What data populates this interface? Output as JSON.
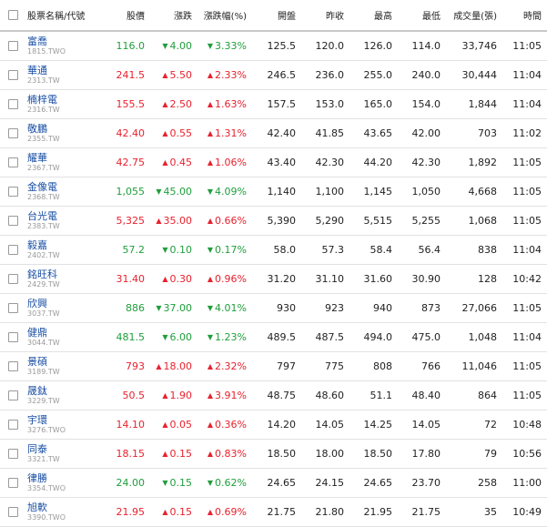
{
  "headers": {
    "name": "股票名稱/代號",
    "price": "股價",
    "change": "漲跌",
    "change_pct": "漲跌幅(%)",
    "open": "開盤",
    "prev_close": "昨收",
    "high": "最高",
    "low": "最低",
    "volume": "成交量(張)",
    "time": "時間"
  },
  "colors": {
    "up": "#e8212e",
    "down": "#1f9e3c",
    "link": "#1a4fa3"
  },
  "rows": [
    {
      "name": "富喬",
      "code": "1815.TWO",
      "price": "116.0",
      "dir": "down",
      "change": "4.00",
      "pct": "3.33%",
      "open": "125.5",
      "prev": "120.0",
      "high": "126.0",
      "low": "114.0",
      "volume": "33,746",
      "time": "11:05"
    },
    {
      "name": "華通",
      "code": "2313.TW",
      "price": "241.5",
      "dir": "up",
      "change": "5.50",
      "pct": "2.33%",
      "open": "246.5",
      "prev": "236.0",
      "high": "255.0",
      "low": "240.0",
      "volume": "30,444",
      "time": "11:04"
    },
    {
      "name": "楠梓電",
      "code": "2316.TW",
      "price": "155.5",
      "dir": "up",
      "change": "2.50",
      "pct": "1.63%",
      "open": "157.5",
      "prev": "153.0",
      "high": "165.0",
      "low": "154.0",
      "volume": "1,844",
      "time": "11:04"
    },
    {
      "name": "敬鵬",
      "code": "2355.TW",
      "price": "42.40",
      "dir": "up",
      "change": "0.55",
      "pct": "1.31%",
      "open": "42.40",
      "prev": "41.85",
      "high": "43.65",
      "low": "42.00",
      "volume": "703",
      "time": "11:02"
    },
    {
      "name": "耀華",
      "code": "2367.TW",
      "price": "42.75",
      "dir": "up",
      "change": "0.45",
      "pct": "1.06%",
      "open": "43.40",
      "prev": "42.30",
      "high": "44.20",
      "low": "42.30",
      "volume": "1,892",
      "time": "11:05"
    },
    {
      "name": "金像電",
      "code": "2368.TW",
      "price": "1,055",
      "dir": "down",
      "change": "45.00",
      "pct": "4.09%",
      "open": "1,140",
      "prev": "1,100",
      "high": "1,145",
      "low": "1,050",
      "volume": "4,668",
      "time": "11:05"
    },
    {
      "name": "台光電",
      "code": "2383.TW",
      "price": "5,325",
      "dir": "up",
      "change": "35.00",
      "pct": "0.66%",
      "open": "5,390",
      "prev": "5,290",
      "high": "5,515",
      "low": "5,255",
      "volume": "1,068",
      "time": "11:05"
    },
    {
      "name": "毅嘉",
      "code": "2402.TW",
      "price": "57.2",
      "dir": "down",
      "change": "0.10",
      "pct": "0.17%",
      "open": "58.0",
      "prev": "57.3",
      "high": "58.4",
      "low": "56.4",
      "volume": "838",
      "time": "11:04"
    },
    {
      "name": "銘旺科",
      "code": "2429.TW",
      "price": "31.40",
      "dir": "up",
      "change": "0.30",
      "pct": "0.96%",
      "open": "31.20",
      "prev": "31.10",
      "high": "31.60",
      "low": "30.90",
      "volume": "128",
      "time": "10:42"
    },
    {
      "name": "欣興",
      "code": "3037.TW",
      "price": "886",
      "dir": "down",
      "change": "37.00",
      "pct": "4.01%",
      "open": "930",
      "prev": "923",
      "high": "940",
      "low": "873",
      "volume": "27,066",
      "time": "11:05"
    },
    {
      "name": "健鼎",
      "code": "3044.TW",
      "price": "481.5",
      "dir": "down",
      "change": "6.00",
      "pct": "1.23%",
      "open": "489.5",
      "prev": "487.5",
      "high": "494.0",
      "low": "475.0",
      "volume": "1,048",
      "time": "11:04"
    },
    {
      "name": "景碩",
      "code": "3189.TW",
      "price": "793",
      "dir": "up",
      "change": "18.00",
      "pct": "2.32%",
      "open": "797",
      "prev": "775",
      "high": "808",
      "low": "766",
      "volume": "11,046",
      "time": "11:05"
    },
    {
      "name": "晟鈦",
      "code": "3229.TW",
      "price": "50.5",
      "dir": "up",
      "change": "1.90",
      "pct": "3.91%",
      "open": "48.75",
      "prev": "48.60",
      "high": "51.1",
      "low": "48.40",
      "volume": "864",
      "time": "11:05"
    },
    {
      "name": "宇環",
      "code": "3276.TWO",
      "price": "14.10",
      "dir": "up",
      "change": "0.05",
      "pct": "0.36%",
      "open": "14.20",
      "prev": "14.05",
      "high": "14.25",
      "low": "14.05",
      "volume": "72",
      "time": "10:48"
    },
    {
      "name": "同泰",
      "code": "3321.TW",
      "price": "18.15",
      "dir": "up",
      "change": "0.15",
      "pct": "0.83%",
      "open": "18.50",
      "prev": "18.00",
      "high": "18.50",
      "low": "17.80",
      "volume": "79",
      "time": "10:56"
    },
    {
      "name": "律勝",
      "code": "3354.TWO",
      "price": "24.00",
      "dir": "down",
      "change": "0.15",
      "pct": "0.62%",
      "open": "24.65",
      "prev": "24.15",
      "high": "24.65",
      "low": "23.70",
      "volume": "258",
      "time": "11:00"
    },
    {
      "name": "旭軟",
      "code": "3390.TWO",
      "price": "21.95",
      "dir": "up",
      "change": "0.15",
      "pct": "0.69%",
      "open": "21.75",
      "prev": "21.80",
      "high": "21.95",
      "low": "21.75",
      "volume": "35",
      "time": "10:49"
    }
  ]
}
